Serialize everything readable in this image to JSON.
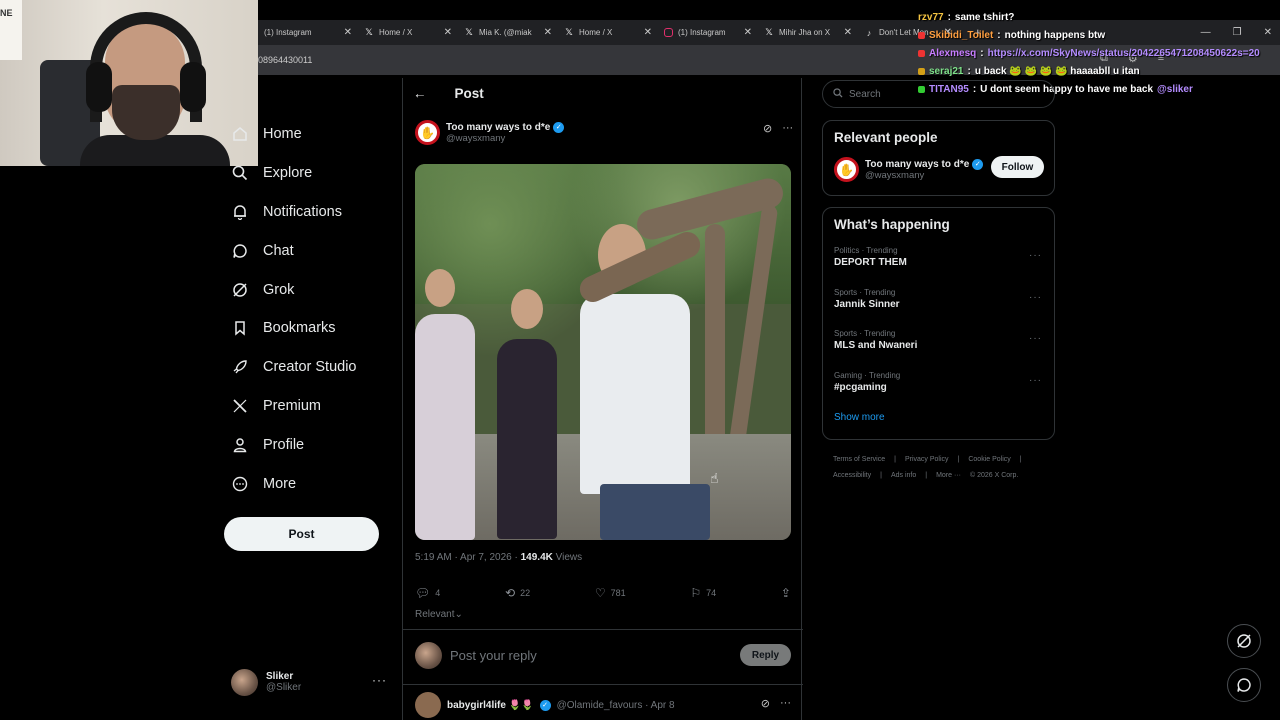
{
  "browser": {
    "tabs": [
      {
        "label": "(1) Instagram",
        "icon": "instagram"
      },
      {
        "label": "Home / X",
        "icon": "x"
      },
      {
        "label": "Mia K. (@miak",
        "icon": "x"
      },
      {
        "label": "Home / X",
        "icon": "x"
      },
      {
        "label": "(1) Instagram",
        "icon": "instagram"
      },
      {
        "label": "Mihir Jha on X",
        "icon": "x"
      },
      {
        "label": "Don't Let Mon",
        "icon": "tiktok"
      }
    ],
    "url_fragment": "08964430011"
  },
  "chat": [
    {
      "user": "rzv77",
      "message": "same tshirt?",
      "user_color": "#f5c542"
    },
    {
      "user": "Skibidi_Toilet",
      "message": "nothing happens btw",
      "user_color": "#ff9f40"
    },
    {
      "user": "Alexmesq",
      "message": "https://x.com/SkyNews/status/2042265471208450622s=20",
      "user_color": "#c77dff"
    },
    {
      "user": "seraj21",
      "message": "u back 🐸 🐸 🐸 🐸 haaaabll u itan",
      "user_color": "#7ee08a"
    },
    {
      "user": "TITAN95",
      "message": "U dont seem happy to have me back",
      "mention": "@sliker",
      "user_color": "#b48cff"
    }
  ],
  "nav": {
    "items": [
      {
        "label": "Home",
        "icon": "home-icon"
      },
      {
        "label": "Explore",
        "icon": "search-icon"
      },
      {
        "label": "Notifications",
        "icon": "bell-icon"
      },
      {
        "label": "Chat",
        "icon": "chat-icon"
      },
      {
        "label": "Grok",
        "icon": "grok-icon"
      },
      {
        "label": "Bookmarks",
        "icon": "bookmark-icon"
      },
      {
        "label": "Creator Studio",
        "icon": "rocket-icon"
      },
      {
        "label": "Premium",
        "icon": "x-logo-icon"
      },
      {
        "label": "Profile",
        "icon": "person-icon"
      },
      {
        "label": "More",
        "icon": "more-circle-icon"
      }
    ],
    "post_button": "Post",
    "profile": {
      "name": "Sliker",
      "handle": "@Sliker"
    }
  },
  "main": {
    "title": "Post",
    "author": {
      "name": "Too many ways to d*e",
      "handle": "@waysxmany"
    },
    "timestamp": "5:19 AM · Apr 7, 2026 · ",
    "views": "149.4K",
    "views_label": " Views",
    "stats": {
      "replies": "4",
      "reposts": "22",
      "likes": "781",
      "bookmarks": "74"
    },
    "sort": "Relevant",
    "reply_placeholder": "Post your reply",
    "reply_button": "Reply",
    "next_post": {
      "name": "babygirl4life 🌷🌷",
      "handle": "@Olamide_favours · Apr 8"
    }
  },
  "sidebar": {
    "search_placeholder": "Search",
    "relevant_title": "Relevant people",
    "relevant_person": {
      "name": "Too many ways to d*e",
      "handle": "@waysxmany",
      "button": "Follow"
    },
    "happening_title": "What’s happening",
    "trends": [
      {
        "category": "Politics · Trending",
        "title": "DEPORT THEM"
      },
      {
        "category": "Sports · Trending",
        "title": "Jannik Sinner"
      },
      {
        "category": "Sports · Trending",
        "title": "MLS and Nwaneri"
      },
      {
        "category": "Gaming · Trending",
        "title": "#pcgaming"
      }
    ],
    "show_more": "Show more",
    "footer": [
      "Terms of Service",
      "|",
      "Privacy Policy",
      "|",
      "Cookie Policy",
      "|",
      "Accessibility",
      "|",
      "Ads info",
      "|",
      "More ···",
      "© 2026 X Corp."
    ]
  },
  "colors": {
    "accent": "#1d9bf0",
    "background": "#000000",
    "border": "#2f3336"
  }
}
